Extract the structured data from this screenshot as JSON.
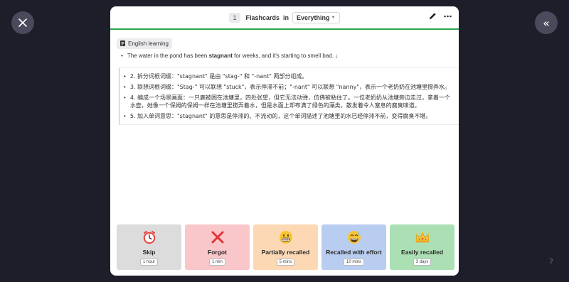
{
  "header": {
    "count": "1",
    "title": "Flashcards",
    "in_label": "in",
    "scope": "Everything"
  },
  "icons": {
    "close": "close-icon",
    "collapse": "double-chevron-left-icon",
    "edit": "pencil-icon",
    "more": "more-icon",
    "doc": "document-icon",
    "help": "question-icon"
  },
  "help_label": "?",
  "collapse_label": "«",
  "card": {
    "tag": "English learning",
    "question_before": "The water in the pond has been ",
    "question_bold": "stagnant",
    "question_after": " for weeks, and it's starting to smell bad. ↓",
    "answers": [
      "2. 拆分词根词缀：\"stagnant\" 是由 \"stag-\" 和 \"-nant\" 两部分组成。",
      "3. 联想词根词缀：\"Stag-\" 可以联想 \"stuck\"，表示停滞不前；\"-nant\" 可以联想 \"nanny\"，表示一个老奶奶在池塘里搅弄水。",
      "4. 编成一个场景画面：一只鹿被困在池塘里，四处张望，但它无法动弹，仿佛被粘住了。一位老奶奶从池塘旁边走过，拿着一个水壶，她像一个保姆的保姆一样在池塘里搅弄着水，但是水面上却布满了绿色的藻类，散发着令人窒息的腐臭味道。",
      "5. 加入单词意思：\"stagnant\" 的意思是停滞的、不流动的，这个单词描述了池塘里的水已经停滞不前，变得腐臭不堪。"
    ]
  },
  "ratings": [
    {
      "label": "Skip",
      "duration": "1 hour",
      "bg": "#dcdcdc",
      "icon": "alarm-clock-icon"
    },
    {
      "label": "Forgot",
      "duration": "1 min",
      "bg": "#f9c6c9",
      "icon": "cross-mark-icon"
    },
    {
      "label": "Partially recalled",
      "duration": "5 mins",
      "bg": "#fdd8b5",
      "icon": "grimacing-face-icon"
    },
    {
      "label": "Recalled with effort",
      "duration": "10 mins",
      "bg": "#b9cdf0",
      "icon": "grinning-sweat-face-icon"
    },
    {
      "label": "Easily recalled",
      "duration": "3 days",
      "bg": "#abdfb4",
      "icon": "crown-icon"
    }
  ],
  "colors": {
    "backdrop": "#1e1e2b",
    "header_accent": "#2da44e",
    "forgot_red": "#e0343a",
    "clock_red": "#e8433a",
    "emoji_yellow": "#f7c531"
  }
}
